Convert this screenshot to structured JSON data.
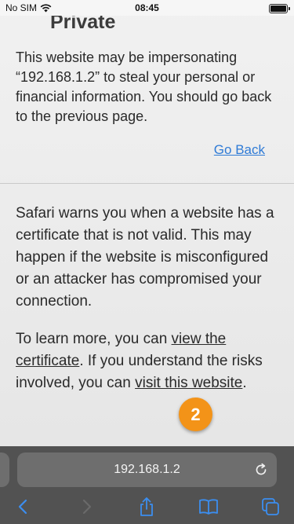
{
  "status_bar": {
    "carrier": "No SIM",
    "time": "08:45",
    "icons": [
      "wifi-icon",
      "battery-icon"
    ]
  },
  "page": {
    "heading": "Private",
    "warning": "This website may be impersonating “192.168.1.2” to steal your personal or financial information. You should go back to the previous page.",
    "go_back": "Go Back",
    "paragraph1": "Safari warns you when a website has a certificate that is not valid. This may happen if the website is misconfigured or an attacker has compromised your connection.",
    "p2_part1": "To learn more, you can ",
    "p2_link1": "view the certificate",
    "p2_part2": ". If you understand the risks involved, you can ",
    "p2_link2": "visit this website",
    "p2_part3": "."
  },
  "badge": {
    "number": "2",
    "color": "#f39318"
  },
  "toolbar": {
    "address": "192.168.1.2",
    "icons": [
      "reload-icon",
      "back-icon",
      "forward-icon",
      "share-icon",
      "bookmarks-icon",
      "tabs-icon"
    ],
    "accent": "#3b8ef0"
  }
}
